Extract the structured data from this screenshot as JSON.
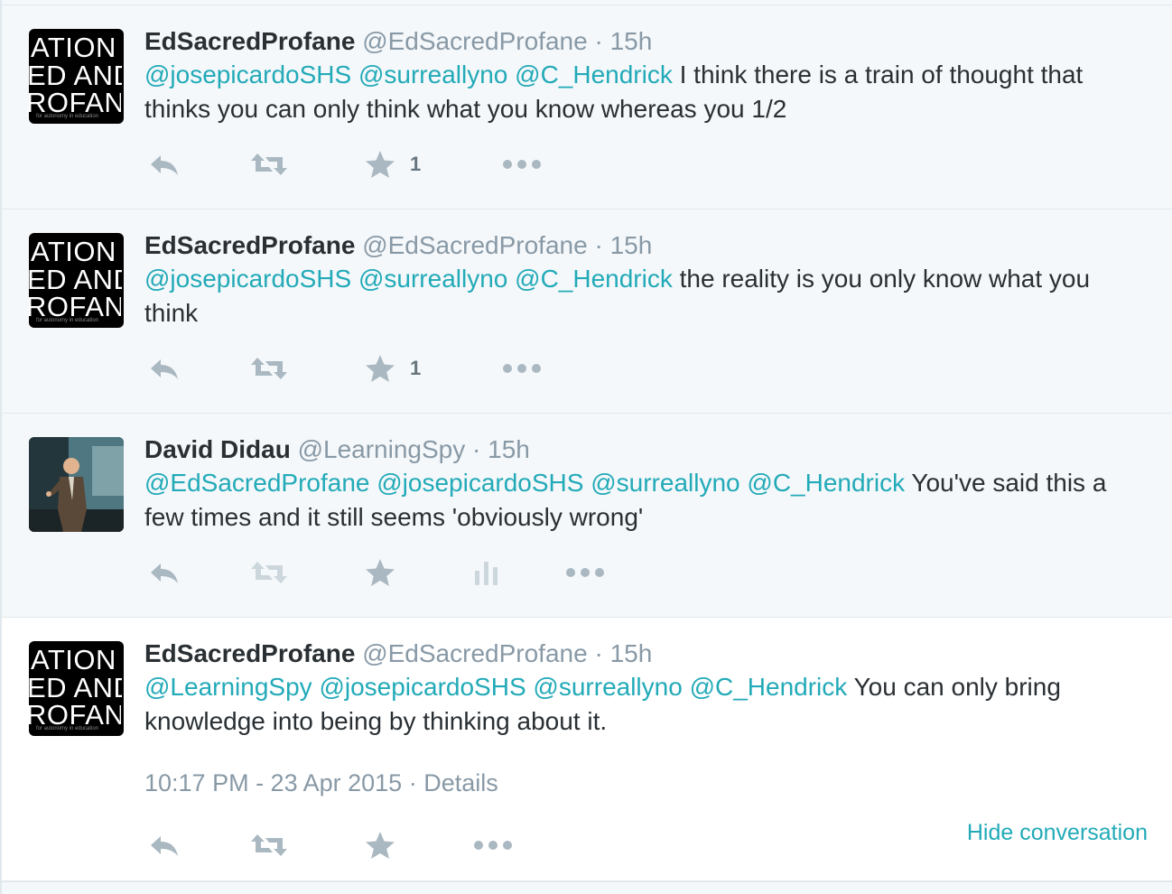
{
  "tweets": [
    {
      "fullname": "EdSacredProfane",
      "screen_name": "@EdSacredProfane",
      "separator": "·",
      "time": "15h",
      "mentions": [
        "@josepicardoSHS",
        "@surreallyno",
        "@C_Hendrick"
      ],
      "text": "I think there is a train of thought that thinks you can only think what you know whereas you 1/2",
      "favorite_count": "1",
      "avatar": {
        "lines": [
          "ATION",
          "ED AND",
          "ROFAN"
        ],
        "tagline": "for autonomy in education"
      }
    },
    {
      "fullname": "EdSacredProfane",
      "screen_name": "@EdSacredProfane",
      "separator": "·",
      "time": "15h",
      "mentions": [
        "@josepicardoSHS",
        "@surreallyno",
        "@C_Hendrick"
      ],
      "text": "the reality is you only know what you think",
      "favorite_count": "1",
      "avatar": {
        "lines": [
          "ATION",
          "ED AND",
          "ROFAN"
        ],
        "tagline": "for autonomy in education"
      }
    },
    {
      "fullname": "David Didau",
      "screen_name": "@LearningSpy",
      "separator": "·",
      "time": "15h",
      "mentions": [
        "@EdSacredProfane",
        "@josepicardoSHS",
        "@surreallyno",
        "@C_Hendrick"
      ],
      "text": "You've said this a few times and it still seems 'obviously wrong'",
      "favorite_count": ""
    },
    {
      "fullname": "EdSacredProfane",
      "screen_name": "@EdSacredProfane",
      "separator": "·",
      "time": "15h",
      "mentions": [
        "@LearningSpy",
        "@josepicardoSHS",
        "@surreallyno",
        "@C_Hendrick"
      ],
      "text": "You can only bring knowledge into being by thinking about it.",
      "timestamp": "10:17 PM - 23 Apr 2015",
      "meta_separator": "·",
      "details_label": "Details",
      "hide_conversation_label": "Hide conversation",
      "avatar": {
        "lines": [
          "ATION",
          "ED AND",
          "ROFAN"
        ],
        "tagline": "for autonomy in education"
      }
    }
  ],
  "icons": {
    "reply": "reply-icon",
    "retweet": "retweet-icon",
    "favorite": "star-icon",
    "analytics": "analytics-icon",
    "more": "more-dots-icon"
  },
  "colors": {
    "link": "#22aab8",
    "muted": "#8899a6",
    "icon": "#aab8c2",
    "text": "#292f33",
    "background": "#f5f8fa"
  }
}
